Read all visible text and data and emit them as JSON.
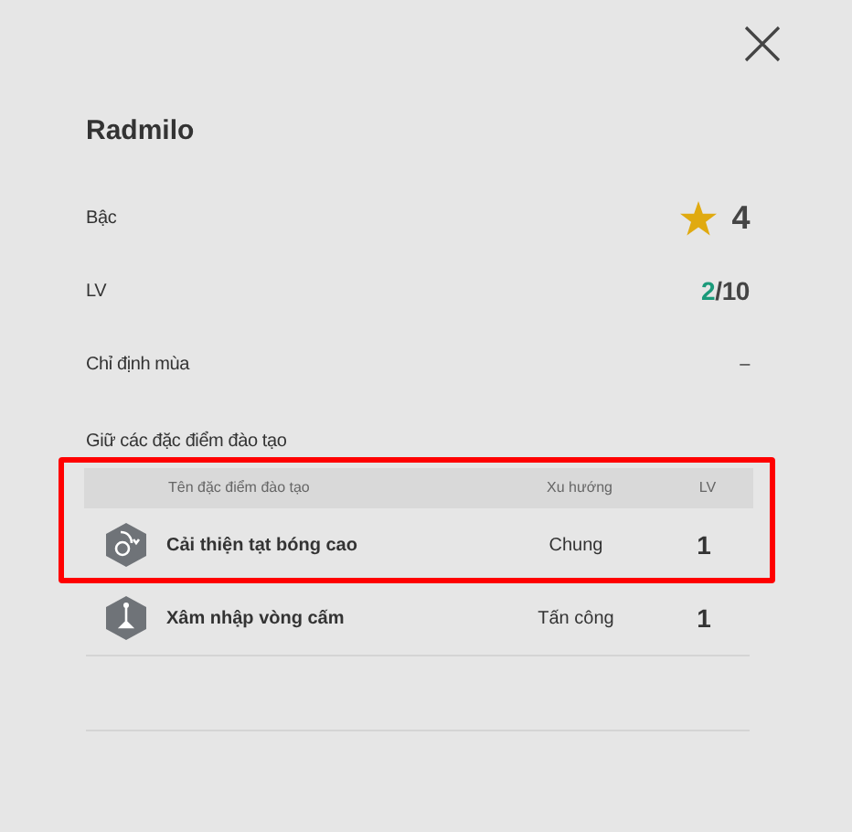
{
  "title": "Radmilo",
  "fields": [
    {
      "kind": "stars",
      "label": "Bậc",
      "value": "4"
    },
    {
      "kind": "level",
      "label": "LV",
      "current": "2",
      "max": "/10"
    },
    {
      "kind": "text",
      "label": "Chỉ định mùa",
      "value": "–"
    }
  ],
  "traits": {
    "heading": "Giữ các đặc điểm đào tạo",
    "highlighted": true,
    "columns": [
      "Tên đặc điểm đào tạo",
      "Xu hướng",
      "LV"
    ],
    "rows": [
      {
        "kind": "cross",
        "name": "Cải thiện tạt bóng cao",
        "tendency": "Chung",
        "level": "1"
      },
      {
        "kind": "run",
        "name": "Xâm nhập vòng cấm",
        "tendency": "Tấn công",
        "level": "1"
      }
    ]
  }
}
